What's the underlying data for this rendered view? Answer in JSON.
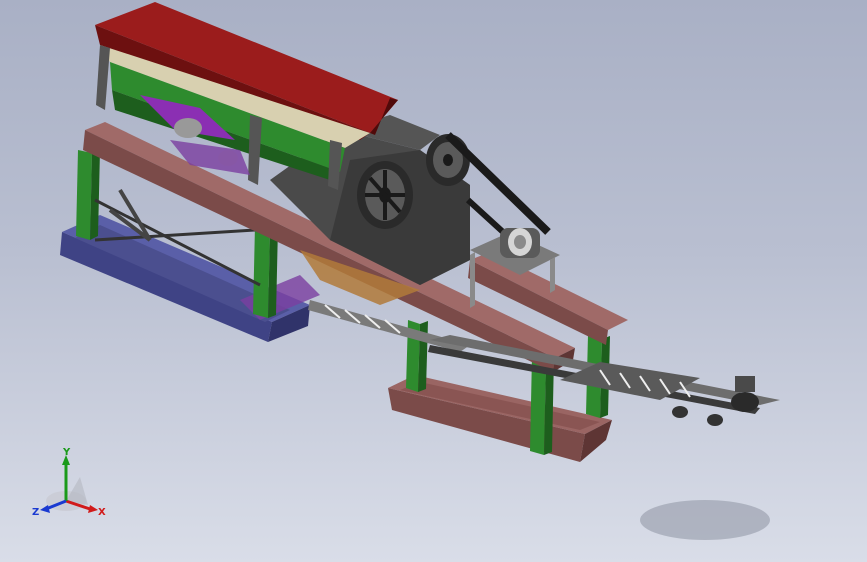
{
  "viewport": {
    "background_top": "#a9b0c5",
    "background_bottom": "#d9dde8"
  },
  "model": {
    "colors": {
      "hopper": "#9b1c1c",
      "hopper_dark": "#6d1010",
      "screen_frame": "#1e7a1e",
      "beam_brown": "#8a5553",
      "beam_dark": "#5e3534",
      "column_green": "#2e8b2e",
      "base_blue": "#4b4f8f",
      "base_purple": "#7a3fa0",
      "crusher_gray": "#4a4a4a",
      "crusher_dark": "#2a2a2a",
      "conveyor_gray": "#6d6d6d"
    }
  },
  "triad": {
    "x_label": "X",
    "y_label": "Y",
    "z_label": "Z",
    "x_color": "#d11a1a",
    "y_color": "#1a9a1a",
    "z_color": "#1a3ad1"
  }
}
